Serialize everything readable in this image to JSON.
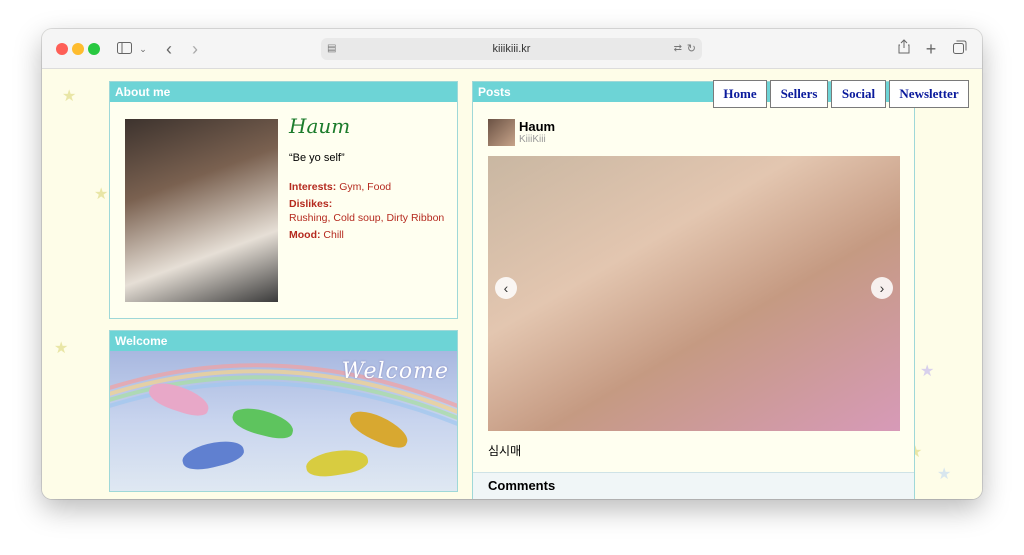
{
  "browser": {
    "url": "kiiikiii.kr"
  },
  "nav": {
    "items": [
      "Home",
      "Sellers",
      "Social",
      "Newsletter"
    ]
  },
  "about": {
    "title": "About me",
    "name": "Haum",
    "quote": "“Be yo self”",
    "interests_label": "Interests:",
    "interests": "Gym, Food",
    "dislikes_label": "Dislikes:",
    "dislikes": "Rushing, Cold soup, Dirty Ribbon",
    "mood_label": "Mood:",
    "mood": "Chill"
  },
  "welcome": {
    "title": "Welcome",
    "banner_text": "Welcome"
  },
  "posts": {
    "title": "Posts",
    "author_name": "Haum",
    "author_handle": "KiiiKiii",
    "caption": "심시매",
    "comments_title": "Comments"
  },
  "colors": {
    "page_bg": "#fefde8",
    "panel_header": "#6dd4d6",
    "nav_text": "#0a1a9c",
    "details_text": "#b52a1f"
  }
}
